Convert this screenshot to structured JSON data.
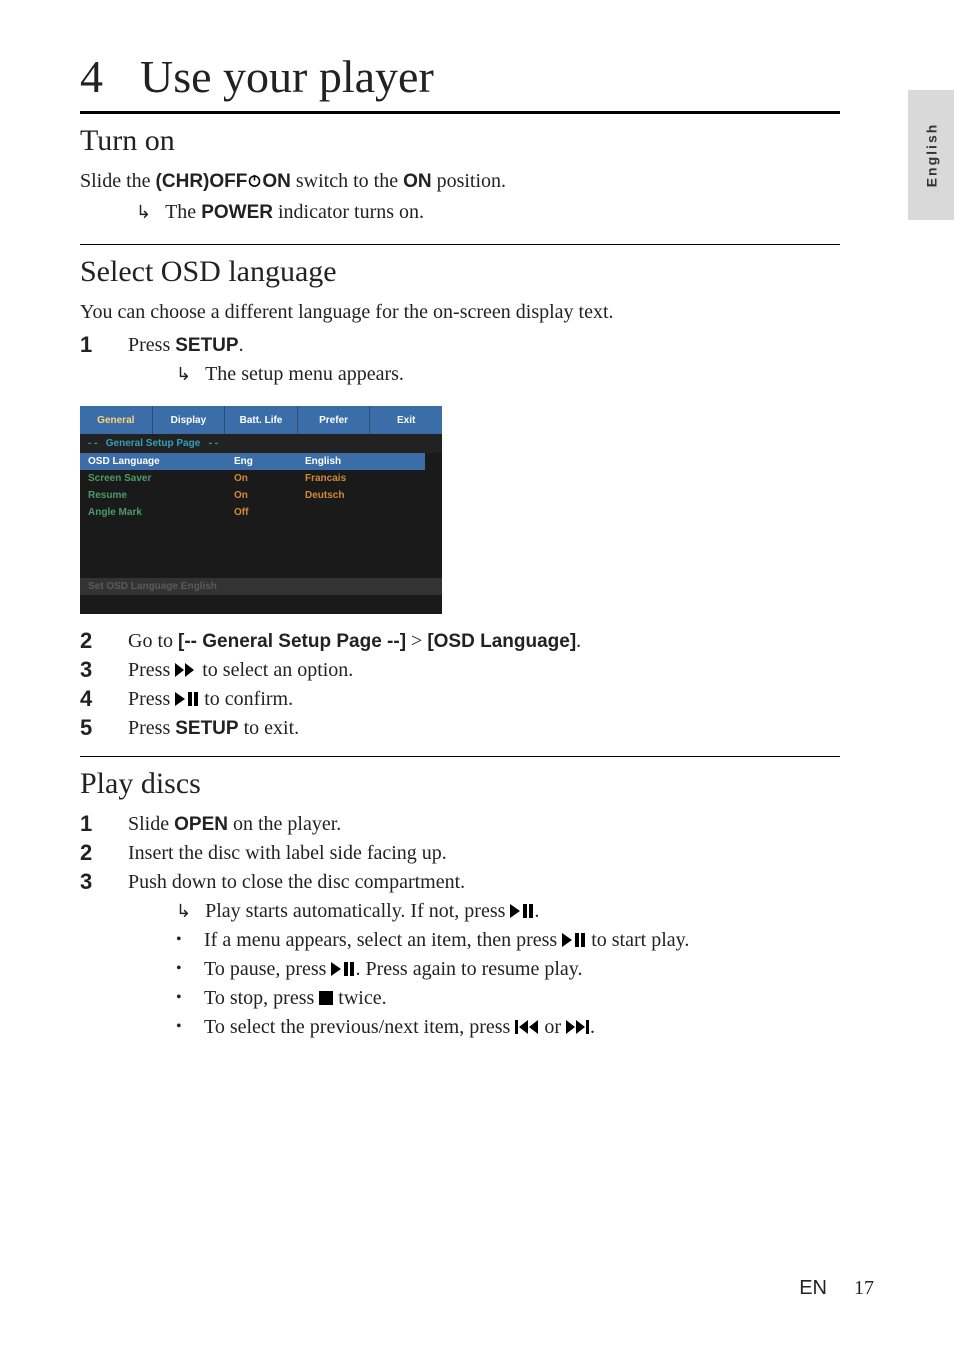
{
  "sideTab": "English",
  "chapter": {
    "num": "4",
    "title": "Use your player"
  },
  "turnOn": {
    "heading": "Turn on",
    "line_pre": "Slide the ",
    "switch_bold_1": "(CHR)OFF",
    "switch_bold_2": "ON",
    "line_mid": " switch to the ",
    "on_bold": "ON",
    "line_end": " position.",
    "result_pre": "The ",
    "result_bold": "POWER",
    "result_post": " indicator turns on."
  },
  "osd": {
    "heading": "Select OSD language",
    "intro": "You can choose a different language for the on-screen display text.",
    "step1_pre": "Press ",
    "step1_bold": "SETUP",
    "step1_post": ".",
    "step1_result": "The setup menu appears.",
    "step2_pre": "Go to ",
    "step2_b1": "[-- General Setup Page --]",
    "step2_gt": " > ",
    "step2_b2": "[OSD Language]",
    "step2_post": ".",
    "step3_pre": "Press ",
    "step3_post": " to select an option.",
    "step4_pre": "Press ",
    "step4_post": " to confirm.",
    "step5_pre": "Press ",
    "step5_bold": "SETUP",
    "step5_post": " to exit."
  },
  "screenshot": {
    "tabs": [
      "General",
      "Display",
      "Batt. Life",
      "Prefer",
      "Exit"
    ],
    "activeTab": 0,
    "subheader": "General Setup Page",
    "rows": [
      {
        "label": "OSD  Language",
        "val": "Eng",
        "sel": true
      },
      {
        "label": "Screen Saver",
        "val": "On",
        "sel": false
      },
      {
        "label": "Resume",
        "val": "On",
        "sel": false
      },
      {
        "label": "Angle Mark",
        "val": "Off",
        "sel": false
      }
    ],
    "options": [
      {
        "label": "English",
        "sel": true
      },
      {
        "label": "Francais",
        "sel": false
      },
      {
        "label": "Deutsch",
        "sel": false
      }
    ],
    "status": "Set OSD Language English"
  },
  "play": {
    "heading": "Play discs",
    "s1_pre": "Slide ",
    "s1_bold": "OPEN",
    "s1_post": " on the player.",
    "s2": "Insert the disc with label side facing up.",
    "s3": "Push down to close the disc compartment.",
    "s3_res_pre": "Play starts automatically. If not, press ",
    "s3_res_post": ".",
    "b1_pre": "If a menu appears, select an item, then press ",
    "b1_post": " to start play.",
    "b2_pre": "To pause, press ",
    "b2_post": ". Press again to resume play.",
    "b3_pre": "To stop, press  ",
    "b3_post": "  twice.",
    "b4_pre": "To select the previous/next item, press ",
    "b4_mid": " or ",
    "b4_post": "."
  },
  "footer": {
    "lang": "EN",
    "page": "17"
  },
  "nums": {
    "n1": "1",
    "n2": "2",
    "n3": "3",
    "n4": "4",
    "n5": "5"
  }
}
